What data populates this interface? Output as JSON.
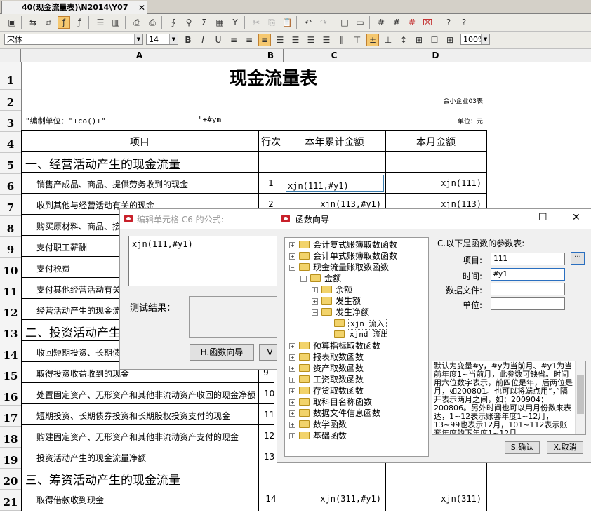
{
  "tab": {
    "title": "40(现金流量表)\\N2014\\Y07",
    "close": "✕"
  },
  "font_bar": {
    "font_name": "宋体",
    "font_size": "14",
    "zoom": "100%"
  },
  "columns": [
    "A",
    "B",
    "C",
    "D"
  ],
  "rows": [
    "1",
    "2",
    "3",
    "4",
    "5",
    "6",
    "7",
    "8",
    "9",
    "10",
    "11",
    "12",
    "13",
    "14",
    "15",
    "16",
    "17",
    "18",
    "19",
    "20",
    "21"
  ],
  "sheet": {
    "title": "现金流量表",
    "form_code": "会小企业03表",
    "unit_formula": "\"编制单位：\"+co()+\"",
    "date_formula": "\"+#ym",
    "unit_label": "单位：元",
    "headers": {
      "item": "项目",
      "line": "行次",
      "year_total": "本年累计金额",
      "month": "本月金额"
    },
    "sec1": "一、经营活动产生的现金流量",
    "sec2": "二、投资活动产生的现金流量",
    "sec3": "三、筹资活动产生的现金流量",
    "r6": {
      "item": "销售产成品、商品、提供劳务收到的现金",
      "line": "1",
      "year": "xjn(111,#y1)",
      "month": "xjn(111)"
    },
    "r7": {
      "item": "收到其他与经营活动有关的现金",
      "line": "2",
      "year": "xjn(113,#y1)",
      "month": "xjn(113)"
    },
    "r8": {
      "item": "购买原材料、商品、接"
    },
    "r9": {
      "item": "支付职工薪酬"
    },
    "r10": {
      "item": "支付税费"
    },
    "r11": {
      "item": "支付其他经营活动有关"
    },
    "r12": {
      "item": "经营活动产生的现金流"
    },
    "r14": {
      "item": "收回短期投资、长期债"
    },
    "r15": {
      "item": "取得投资收益收到的现金",
      "line": "9"
    },
    "r16": {
      "item": "处置固定资产、无形资产和其他非流动资产收回的现金净额",
      "line": "10"
    },
    "r17": {
      "item": "短期投资、长期债券投资和长期股权投资支付的现金",
      "line": "11"
    },
    "r18": {
      "item": "购建固定资产、无形资产和其他非流动资产支付的现金",
      "line": "12"
    },
    "r19": {
      "item": "投资活动产生的现金流量净额",
      "line": "13"
    },
    "r21": {
      "item": "取得借款收到现金",
      "line": "14",
      "year": "xjn(311,#y1)",
      "month": "xjn(311)"
    }
  },
  "edit_dialog": {
    "title": "编辑单元格 C6 的公式:",
    "formula": "xjn(111,#y1)",
    "test_label": "测试结果：",
    "wizard_button": "H.函数向导",
    "v_button": "V"
  },
  "wizard": {
    "title": "函数向导",
    "params_title": "C.以下是函数的参数表:",
    "labels": {
      "item": "项目:",
      "time": "时间:",
      "datafile": "数据文件:",
      "unit": "单位:"
    },
    "values": {
      "item": "111",
      "time": "#y1",
      "datafile": "",
      "unit": ""
    },
    "more_button": "···",
    "tree": [
      "会计复式账簿取数函数",
      "会计单式账簿取数函数",
      "现金流量账取数函数",
      "金额",
      "余额",
      "发生额",
      "发生净额",
      "xjn 流入",
      "xjnd 流出",
      "预算指标取数函数",
      "报表取数函数",
      "资产取数函数",
      "工资取数函数",
      "存货取数函数",
      "取科目名称函数",
      "数据文件信息函数",
      "数学函数",
      "基础函数"
    ],
    "description": "默认为变量#y，#y为当前月、#y1为当前年度1~当前月，此参数可缺省。时间用六位数字表示，前四位是年，后两位是月，如200801。也可以将端点用“，”隔开表示两月之间，如：200904：200806。另外时间也可以用月份数来表达，1~12表示账套年度1~12月，13~99也表示12月，101~112表示账套年度的下年度1~12月",
    "ok_button": "S.确认",
    "cancel_button": "X.取消",
    "min": "—",
    "max": "☐",
    "close": "✕"
  },
  "colors": {
    "accent": "#f5c870",
    "title_icon": "#c8202a",
    "folder": "#f2d36b",
    "selection": "#3c7fb1"
  }
}
